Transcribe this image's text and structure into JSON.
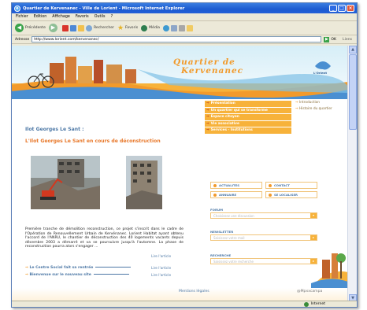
{
  "window": {
    "title": "Quartier de Kervenanec - Ville de Lorient - Microsoft Internet Explorer",
    "ie_glyph": "e"
  },
  "menu": [
    "Fichier",
    "Edition",
    "Affichage",
    "Favoris",
    "Outils",
    "?"
  ],
  "toolbar": {
    "back": "Précédente",
    "search": "Rechercher",
    "favorites": "Favoris",
    "media": "Média"
  },
  "address": {
    "label": "Adresse",
    "url": "http://www.lorient.com/kervenanec/",
    "go": "OK",
    "links": "Liens"
  },
  "status": {
    "zone": "Internet"
  },
  "site": {
    "title_line1": "Quartier de",
    "title_line2": "Kervenanec",
    "logo_text": "L'Orient"
  },
  "nav": {
    "items": [
      "Présentation",
      "Un quartier qui se transforme",
      "Espace citoyen",
      "Vie associative",
      "Services - Institutions"
    ],
    "sub_items": [
      "Introduction",
      "Histoire du quartier"
    ]
  },
  "article": {
    "page_title": "Ilot Georges Le Sant :",
    "subtitle": "L'Ilot Georges Le Sant en cours de déconstruction",
    "paragraph": "Première tranche de démolition reconstruction, ce projet s'inscrit dans le cadre de l'Opération de Renouvellement Urbain de Kervénanec. Lorient Habitat ayant obtenu l'accord de l'ANRU, le chantier de déconstruction des 40 logements vacants depuis décembre 2003 a démarré et va se poursuivre jusqu'à l'automne. La phase de reconstruction pourra alors s'engager ...",
    "read_more": "Lire l'article"
  },
  "links": [
    {
      "text": "Le Centre Social fait sa rentrée",
      "more": "Lire l'article"
    },
    {
      "text": "Bienvenue sur le nouveau site",
      "more": "Lire l'article"
    }
  ],
  "right": {
    "buttons": [
      "ACTUALITES",
      "CONTACT",
      "ANNUAIRE",
      "SE LOCALISER"
    ],
    "forum_label": "FORUM",
    "forum_placeholder": "Choisissez une discussion",
    "newsletter_label": "NEWSLETTER",
    "newsletter_placeholder": "Saisissez votre mail",
    "search_label": "RECHERCHE",
    "search_placeholder": "Saisissez votre recherche"
  },
  "footer": {
    "legal": "Mentions légales",
    "credit": "@Mpxxcampa"
  },
  "icons": {
    "back": "back-arrow-icon",
    "forward": "forward-arrow-icon",
    "stop": "stop-icon",
    "refresh": "refresh-icon",
    "home": "home-icon",
    "search": "search-icon",
    "favorites": "star-icon",
    "media": "media-icon",
    "history": "history-icon",
    "mail": "mail-icon",
    "print": "print-icon",
    "edit": "folder-icon"
  },
  "colors": {
    "accent": "#f29a2b",
    "nav": "#f7b23a",
    "link": "#4d78a6",
    "titlebar": "#1c5bd0"
  }
}
